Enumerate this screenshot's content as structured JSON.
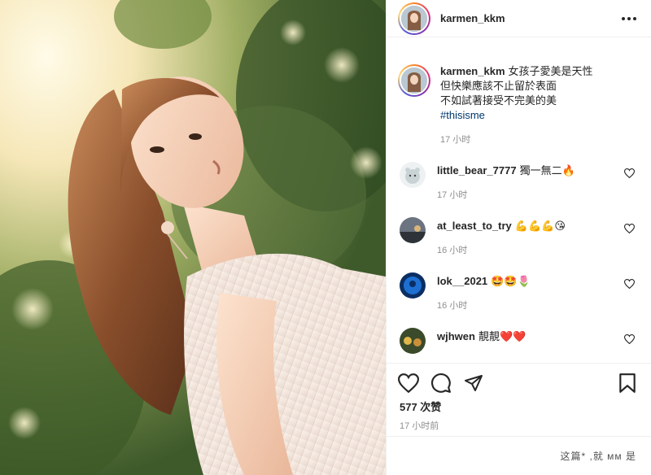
{
  "post": {
    "username": "karmen_kkm",
    "caption_username": "karmen_kkm",
    "caption_line1": "女孩子愛美是天性",
    "caption_line2": "但快樂應該不止留於表面",
    "caption_line3": "不如試著接受不完美的美",
    "hashtag": "#thisisme",
    "caption_time": "17 小时",
    "likes": "577 次赞",
    "posted": "17 小时前"
  },
  "comments": [
    {
      "username": "little_bear_7777",
      "text": "獨一無二🔥",
      "time": "17 小时"
    },
    {
      "username": "at_least_to_try",
      "text": "💪💪💪😘",
      "time": "16 小时"
    },
    {
      "username": "lok__2021",
      "text": "🤩🤩🌷",
      "time": "16 小时"
    },
    {
      "username": "wjhwen",
      "text": "靚靚❤️❤️",
      "time": ""
    }
  ],
  "add_comment": {
    "placeholder": ""
  },
  "watermark": "这篇* ,就 ᴍᴍ 是"
}
